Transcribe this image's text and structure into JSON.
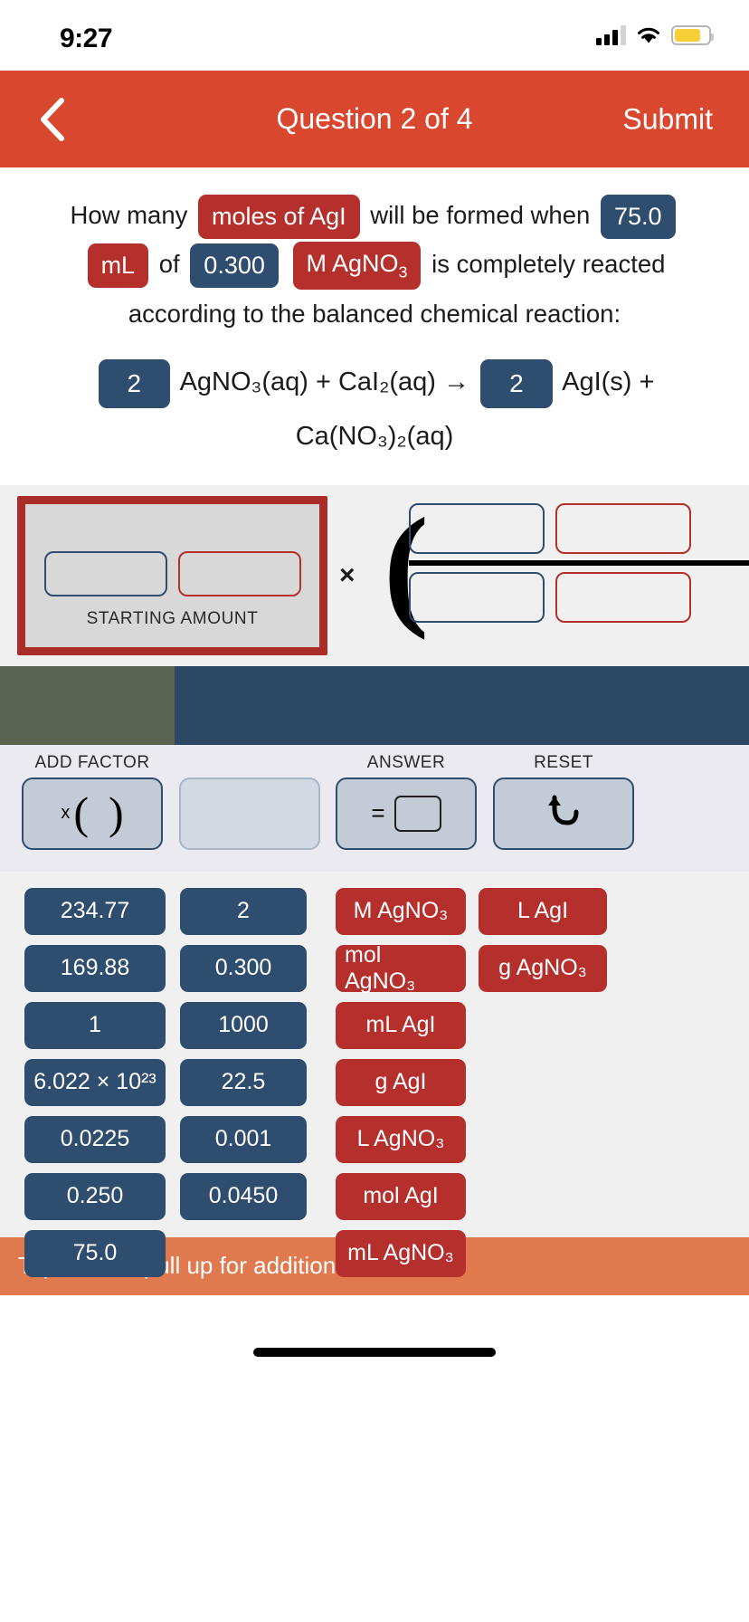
{
  "status_bar": {
    "time": "9:27",
    "signal_icon": "cellular-signal-icon",
    "wifi_icon": "wifi-icon",
    "battery_icon": "battery-icon"
  },
  "nav": {
    "back_icon": "chevron-left-icon",
    "title": "Question 2 of 4",
    "submit_label": "Submit"
  },
  "question": {
    "part1": "How many",
    "chip_moles_agi": "moles of AgI",
    "part2": "will be formed when",
    "chip_75": "75.0",
    "chip_ml": "mL",
    "part3": "of",
    "chip_0300": "0.300",
    "chip_m_agno3": "M AgNO",
    "chip_m_agno3_sub": "3",
    "part4": "is completely reacted",
    "part5": "according to the balanced chemical reaction:",
    "equation": {
      "coeff1": "2",
      "reactants": "AgNO₃(aq) + CaI₂(aq) →",
      "coeff2": "2",
      "product1": "AgI(s) +",
      "product2": "Ca(NO₃)₂(aq)"
    }
  },
  "work_area": {
    "starting_amount_label": "STARTING AMOUNT",
    "multiply_symbol": "×",
    "paren_symbol": "(",
    "slots": [
      {
        "name": "starting-value-slot",
        "color": "blue"
      },
      {
        "name": "starting-unit-slot",
        "color": "red"
      },
      {
        "name": "numerator-value-slot",
        "color": "blue"
      },
      {
        "name": "numerator-unit-slot",
        "color": "red"
      },
      {
        "name": "denominator-value-slot",
        "color": "blue"
      },
      {
        "name": "denominator-unit-slot",
        "color": "red"
      }
    ]
  },
  "band": {
    "olive_color": "#5a6350",
    "navy_color": "#2c4865"
  },
  "toolbar": {
    "add_factor_label": "ADD FACTOR",
    "add_factor_glyph_x": "x",
    "add_factor_glyph_open": "(",
    "add_factor_glyph_close": ")",
    "answer_label": "ANSWER",
    "answer_glyph_eq": "=",
    "reset_label": "RESET",
    "reset_glyph": "↺"
  },
  "tiles": {
    "column1": [
      "234.77",
      "169.88",
      "1",
      "6.022 × 10²³",
      "0.0225",
      "0.250",
      "75.0"
    ],
    "column2": [
      "2",
      "0.300",
      "1000",
      "22.5",
      "0.001",
      "0.0450"
    ],
    "column3": [
      "M AgNO₃",
      "mol AgNO₃",
      "mL AgI",
      "g AgI",
      "L AgNO₃",
      "mol AgI",
      "mL AgNO₃"
    ],
    "column4": [
      "L AgI",
      "g AgNO₃"
    ]
  },
  "footer": {
    "resources_label": "Tap here or pull up for additional resources"
  },
  "colors": {
    "nav_red": "#d8472e",
    "chip_red": "#b5302c",
    "chip_navy": "#2f4d6e",
    "resources_orange": "#e07a4e",
    "work_bg": "#f0f0f0",
    "start_box_bg": "#d8d8d8",
    "start_box_border": "#ab2d2a"
  }
}
